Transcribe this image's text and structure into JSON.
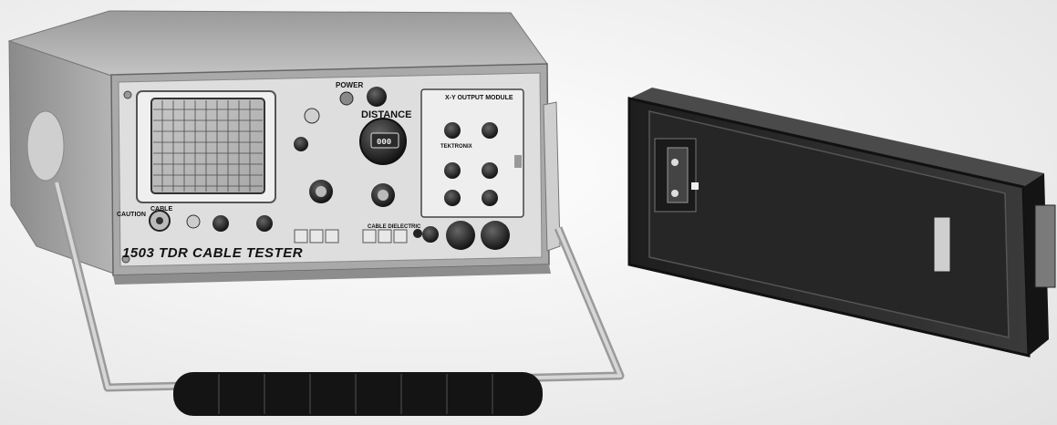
{
  "photo": {
    "subject": "tdr-cable-tester-with-module",
    "labels": {
      "model": "1503 TDR CABLE TESTER",
      "caution": "CAUTION",
      "cable": "CABLE",
      "power": "POWER",
      "distance": "DISTANCE",
      "xy_module": "X-Y OUTPUT MODULE",
      "tektronix": "TEKTRONIX",
      "dielectric": "CABLE DIELECTRIC",
      "counter": "000"
    }
  },
  "colors": {
    "background": "#efefef",
    "case_body": "#b9b9b9",
    "front_panel": "#dcdcdc",
    "module_body": "#2a2a2a",
    "handle_grip": "#111111",
    "knob": "#1a1a1a"
  }
}
